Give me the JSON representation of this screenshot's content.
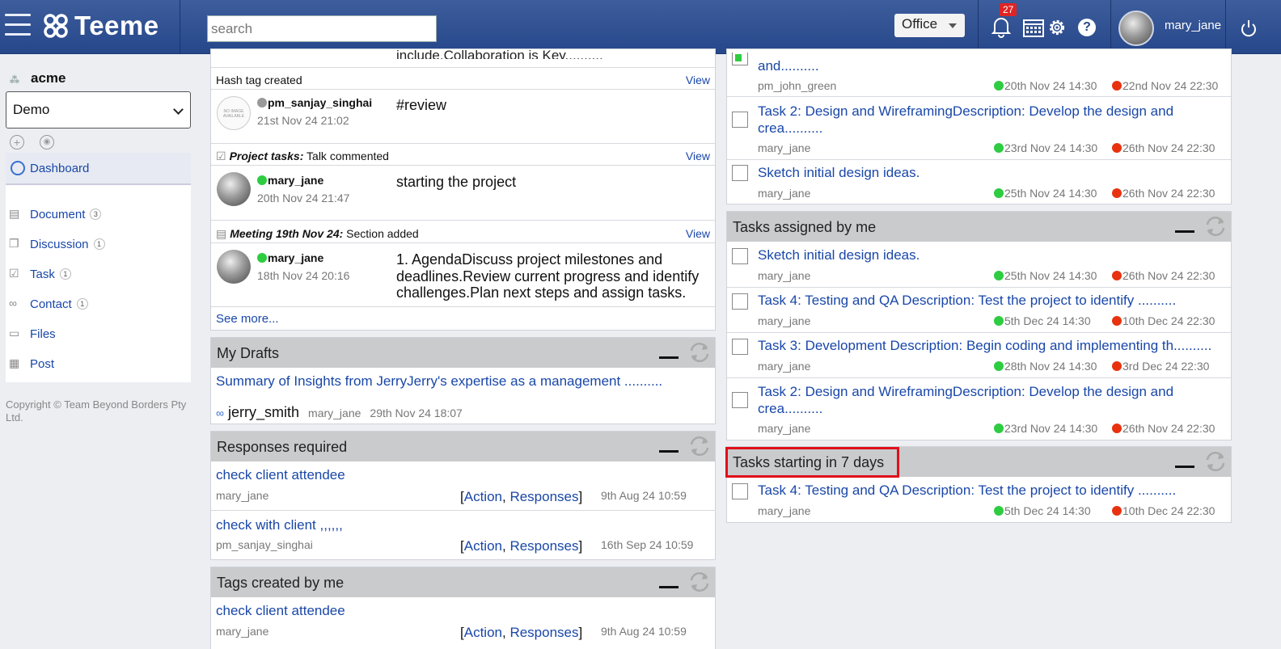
{
  "app": {
    "brand": "Teeme",
    "search_placeholder": "search",
    "workspace": "Office",
    "notifications": "27",
    "username": "mary_jane"
  },
  "sidebar": {
    "org": "acme",
    "project": "Demo",
    "items": [
      {
        "label": "Dashboard"
      },
      {
        "label": "Document",
        "count": "3"
      },
      {
        "label": "Discussion",
        "count": "1"
      },
      {
        "label": "Task",
        "count": "1"
      },
      {
        "label": "Contact",
        "count": "1"
      },
      {
        "label": "Files"
      },
      {
        "label": "Post"
      }
    ],
    "copyright": "Copyright © Team Beyond Borders Pty Ltd."
  },
  "activity": {
    "top_fragment": "include.Collaboration is Key..........",
    "items": [
      {
        "header_plain": "Hash tag created",
        "view": "View",
        "user": "pm_sanjay_singhai",
        "time": "21st Nov 24 21:02",
        "text": "#review",
        "noimage": "NO IMAGE AVAILABLE"
      },
      {
        "header_bold": "Project tasks:",
        "header_rest": " Talk commented",
        "view": "View",
        "user": "mary_jane",
        "time": "20th Nov 24 21:47",
        "text": "starting the project"
      },
      {
        "header_bold": "Meeting 19th Nov 24:",
        "header_rest": " Section added",
        "view": "View",
        "user": "mary_jane",
        "time": "18th Nov 24 20:16",
        "text_lines": [
          "1. AgendaDiscuss project milestones and",
          "deadlines.Review current progress and identify",
          "challenges.Plan next steps and assign tasks."
        ]
      }
    ],
    "see_more": "See more..."
  },
  "drafts": {
    "title": "My Drafts",
    "item": {
      "title": "Summary of Insights from JerryJerry's expertise as a management ..........",
      "contact": "jerry_smith",
      "user": "mary_jane",
      "time": "29th Nov 24 18:07"
    }
  },
  "responses": {
    "title": "Responses required",
    "items": [
      {
        "title": "check client attendee",
        "user": "mary_jane",
        "action": "Action",
        "responses": "Responses",
        "time": "9th Aug 24 10:59"
      },
      {
        "title": "check with client ,,,,,,",
        "user": "pm_sanjay_singhai",
        "action": "Action",
        "responses": "Responses",
        "time": "16th Sep 24 10:59"
      }
    ]
  },
  "tags": {
    "title": "Tags created by me",
    "items": [
      {
        "title": "check client attendee",
        "user": "mary_jane",
        "action": "Action",
        "responses": "Responses",
        "time": "9th Aug 24 10:59"
      }
    ]
  },
  "tasks_top": {
    "items": [
      {
        "title_lines": [
          "and.........."
        ],
        "user": "pm_john_green",
        "start": "20th Nov 24 14:30",
        "end": "22nd Nov 24 22:30"
      },
      {
        "title_lines": [
          "Task 2: Design and WireframingDescription: Develop the design and",
          "crea.........."
        ],
        "user": "mary_jane",
        "start": "23rd Nov 24 14:30",
        "end": "26th Nov 24 22:30"
      },
      {
        "title_lines": [
          "Sketch initial design ideas."
        ],
        "user": "mary_jane",
        "start": "25th Nov 24 14:30",
        "end": "26th Nov 24 22:30"
      }
    ]
  },
  "assigned": {
    "title": "Tasks assigned by me",
    "items": [
      {
        "title_lines": [
          "Sketch initial design ideas."
        ],
        "user": "mary_jane",
        "start": "25th Nov 24 14:30",
        "end": "26th Nov 24 22:30"
      },
      {
        "title_lines": [
          "Task 4: Testing and QA Description: Test the project to identify .........."
        ],
        "user": "mary_jane",
        "start": "5th Dec 24 14:30",
        "end": "10th Dec 24 22:30"
      },
      {
        "title_lines": [
          "Task 3: Development Description: Begin coding and implementing th.........."
        ],
        "user": "mary_jane",
        "start": "28th Nov 24 14:30",
        "end": "3rd Dec 24 22:30"
      },
      {
        "title_lines": [
          "Task 2: Design and WireframingDescription: Develop the design and",
          "crea.........."
        ],
        "user": "mary_jane",
        "start": "23rd Nov 24 14:30",
        "end": "26th Nov 24 22:30"
      }
    ]
  },
  "starting": {
    "title": "Tasks starting in 7 days",
    "highlight_color": "#e0101a",
    "items": [
      {
        "title_lines": [
          "Task 4: Testing and QA Description: Test the project to identify .........."
        ],
        "user": "mary_jane",
        "start": "5th Dec 24 14:30",
        "end": "10th Dec 24 22:30"
      }
    ]
  }
}
